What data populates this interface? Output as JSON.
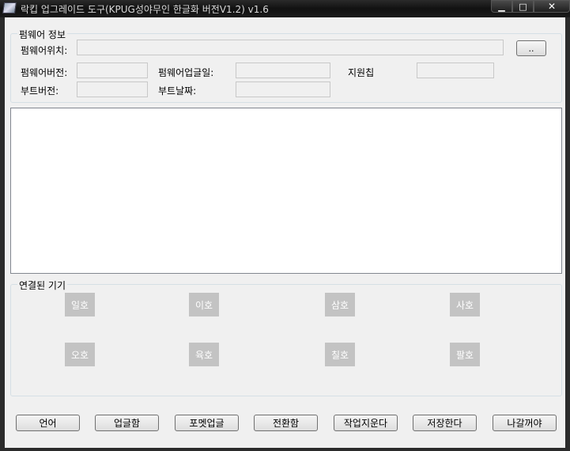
{
  "window": {
    "title": "락킵 업그레이드 도구(KPUG성야무인 한글화 버전V1.2) v1.6",
    "min_glyph": "▁",
    "max_glyph": "□",
    "close_glyph": "✕"
  },
  "firmware": {
    "group_title": "펌웨어 정보",
    "location_label": "펌웨어위치:",
    "location_value": "",
    "browse_label": "..",
    "version_label": "펌웨어버전:",
    "version_value": "",
    "upgrade_date_label": "펌웨어업글일:",
    "upgrade_date_value": "",
    "chip_label": "지원칩",
    "chip_value": "",
    "boot_version_label": "부트버전:",
    "boot_version_value": "",
    "boot_date_label": "부트날짜:",
    "boot_date_value": ""
  },
  "log": {
    "text": ""
  },
  "devices": {
    "group_title": "연결된 기기",
    "slots": [
      "일호",
      "이호",
      "삼호",
      "사호",
      "오호",
      "육호",
      "칠호",
      "팔호"
    ]
  },
  "buttons": {
    "language": "언어",
    "upgrade": "업글함",
    "format_upgrade": "포멧업글",
    "switch": "전환함",
    "erase": "작업지운다",
    "save": "저장한다",
    "exit": "나갈꺼야"
  }
}
